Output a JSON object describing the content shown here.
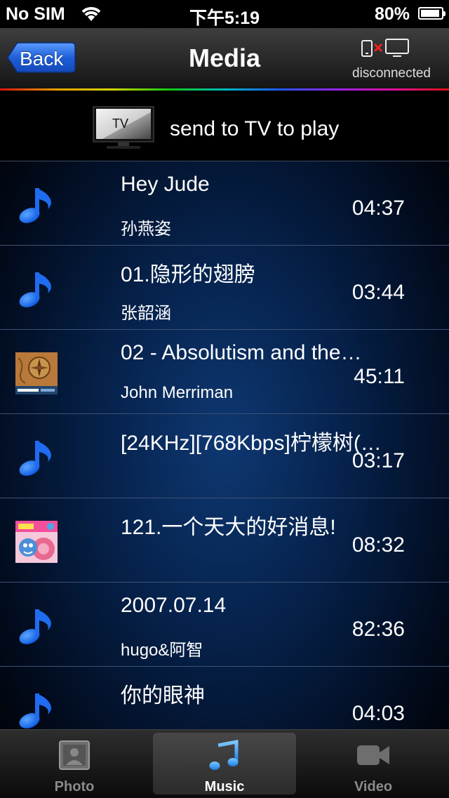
{
  "status_bar": {
    "carrier": "No SIM",
    "time": "下午5:19",
    "battery": "80%",
    "battery_level": 0.8
  },
  "navbar": {
    "back_label": "Back",
    "title": "Media",
    "connection_status": "disconnected",
    "connection_icon": "device-disconnected-tv-icon"
  },
  "tv_row": {
    "icon_label": "TV",
    "text": "send to TV to play"
  },
  "items": [
    {
      "title": "Hey Jude",
      "artist": "孙燕姿",
      "duration": "04:37",
      "icon": "music-note-icon"
    },
    {
      "title": "01.隐形的翅膀",
      "artist": "张韶涵",
      "duration": "03:44",
      "icon": "music-note-icon"
    },
    {
      "title": "02 - Absolutism and the…",
      "artist": "John Merriman",
      "duration": "45:11",
      "icon": "album-art-open-yale"
    },
    {
      "title": "[24KHz][768Kbps]柠檬树(…",
      "artist": "",
      "duration": "03:17",
      "icon": "music-note-icon"
    },
    {
      "title": "121.一个天大的好消息!",
      "artist": "",
      "duration": "08:32",
      "icon": "album-art-kids"
    },
    {
      "title": "2007.07.14",
      "artist": "hugo&阿智",
      "duration": "82:36",
      "icon": "music-note-icon"
    },
    {
      "title": "你的眼神",
      "artist": "",
      "duration": "04:03",
      "icon": "music-note-icon"
    }
  ],
  "tabs": [
    {
      "label": "Photo",
      "icon": "photo-icon",
      "selected": false
    },
    {
      "label": "Music",
      "icon": "music-icon",
      "selected": true
    },
    {
      "label": "Video",
      "icon": "video-camera-icon",
      "selected": false
    }
  ],
  "colors": {
    "accent_blue": "#1a6cff",
    "background": "#06224c"
  }
}
